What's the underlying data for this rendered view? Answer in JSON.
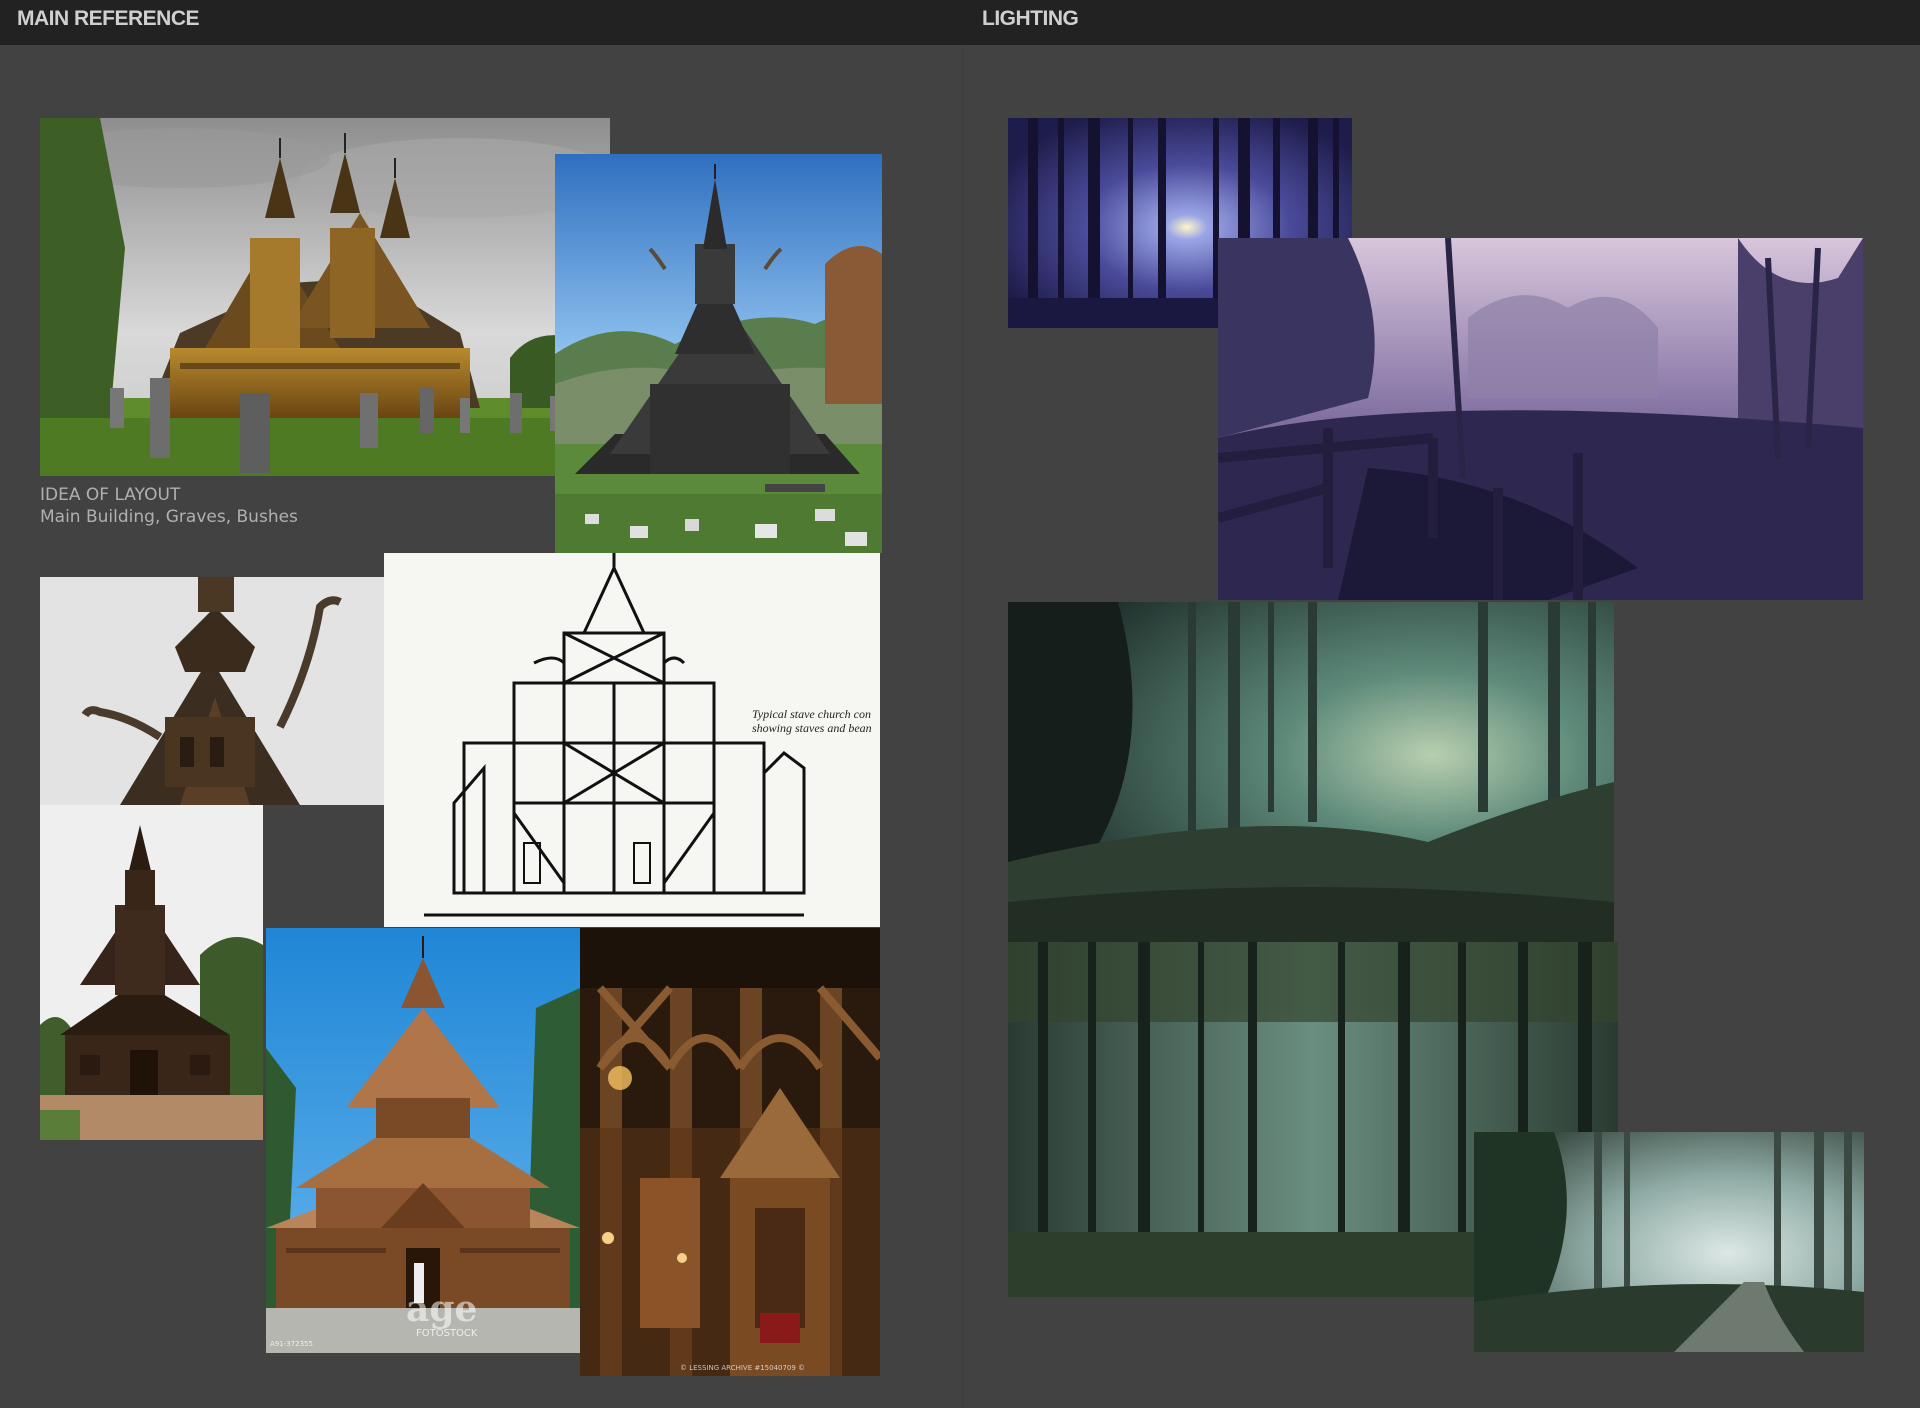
{
  "header": {
    "left_title": "MAIN REFERENCE",
    "right_title": "LIGHTING"
  },
  "main_reference": {
    "caption_line1": "IDEA OF LAYOUT",
    "caption_line2": "Main Building, Graves, Bushes",
    "diagram_line1": "Typical stave church con",
    "diagram_line2": "showing staves and bean",
    "watermark_age": "age",
    "watermark_fotostock": "FOTOSTOCK",
    "watermark_code": "A91-372355",
    "watermark_lessing": "© LESSING ARCHIVE #15040709 ©",
    "images": [
      {
        "name": "heddal-stave-church-photo"
      },
      {
        "name": "hopperstad-stave-church-photo"
      },
      {
        "name": "dragon-roof-detail-photo"
      },
      {
        "name": "stave-church-cross-section-drawing"
      },
      {
        "name": "gol-stave-church-photo"
      },
      {
        "name": "stave-church-blue-sky-photo"
      },
      {
        "name": "stave-church-interior-photo"
      }
    ]
  },
  "lighting": {
    "images": [
      {
        "name": "moonlit-blue-forest-photo"
      },
      {
        "name": "purple-misty-bridge-photo"
      },
      {
        "name": "green-foggy-forest-clearing-photo"
      },
      {
        "name": "dark-green-misty-forest-photo"
      },
      {
        "name": "foggy-forest-path-photo"
      }
    ]
  },
  "colors": {
    "background": "#424242",
    "topbar": "#222222",
    "title_text": "#d0d0d0",
    "caption_text": "#b0b0b0"
  }
}
